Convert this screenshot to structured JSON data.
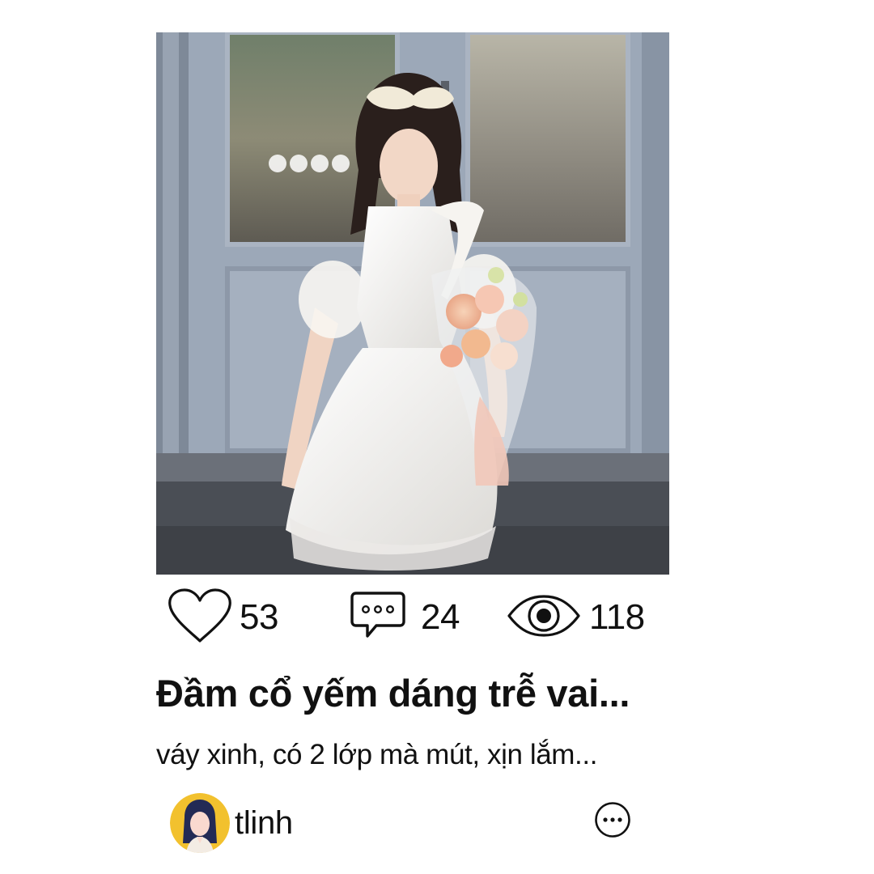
{
  "post": {
    "photo_icon": "product-photo-white-dress",
    "stats": {
      "likes": "53",
      "comments": "24",
      "views": "118"
    },
    "icons": {
      "like": "heart-icon",
      "comment": "comment-bubble-icon",
      "view": "eye-icon",
      "more": "more-options-icon"
    },
    "title": "Đầm cổ yếm dáng trễ vai...",
    "description": "váy xinh, có 2 lớp mà mút, xịn lắm...",
    "author": {
      "username": "tlinh",
      "avatar_bg": "#f2c12e"
    }
  },
  "colors": {
    "text": "#111111",
    "door": "#9aa6b6",
    "dress": "#f4f3f0"
  }
}
